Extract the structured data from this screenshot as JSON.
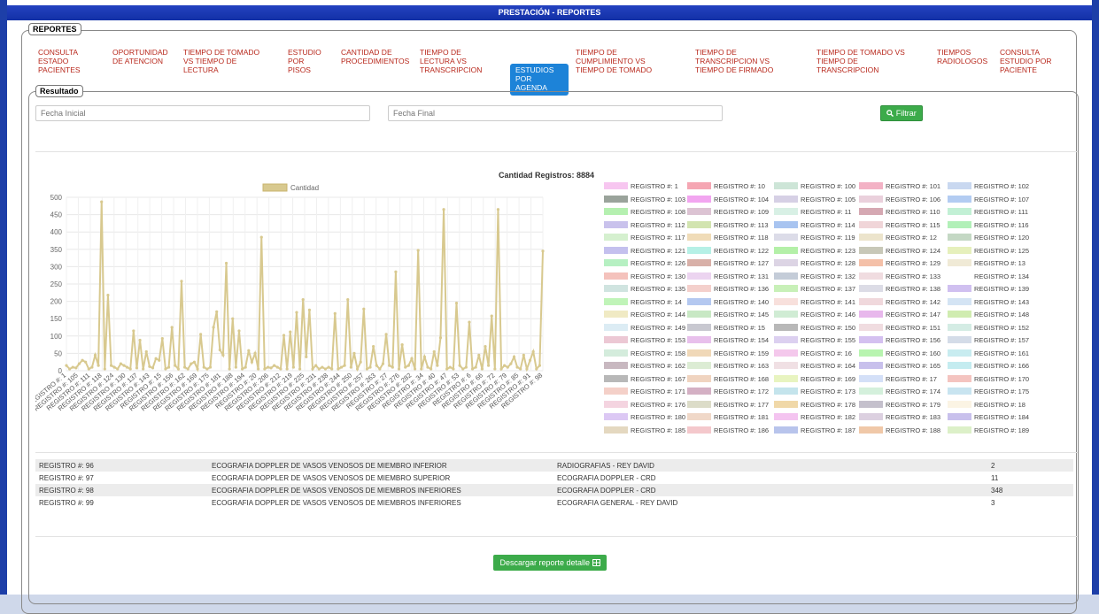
{
  "window_title": "PRESTACIÓN - REPORTES",
  "section_label": "REPORTES",
  "result_label": "Resultado",
  "nav": [
    {
      "label": "CONSULTA ESTADO PACIENTES",
      "active": false
    },
    {
      "label": "OPORTUNIDAD DE ATENCION",
      "active": false
    },
    {
      "label": "TIEMPO DE TOMADO VS TIEMPO DE LECTURA",
      "active": false
    },
    {
      "label": "ESTUDIO POR PISOS",
      "active": false
    },
    {
      "label": "CANTIDAD DE PROCEDIMIENTOS",
      "active": false
    },
    {
      "label": "TIEMPO DE LECTURA VS TRANSCRIPCION",
      "active": false
    },
    {
      "label": "ESTUDIOS POR AGENDA",
      "active": true
    },
    {
      "label": "TIEMPO DE CUMPLIMIENTO VS TIEMPO DE TOMADO",
      "active": false
    },
    {
      "label": "TIEMPO DE TRANSCRIPCION VS TIEMPO DE FIRMADO",
      "active": false
    },
    {
      "label": "TIEMPO DE TOMADO VS TIEMPO DE TRANSCRIPCION",
      "active": false
    },
    {
      "label": "TIEMPOS RADIOLOGOS",
      "active": false
    },
    {
      "label": "CONSULTA ESTUDIO POR PACIENTE",
      "active": false
    }
  ],
  "filters": {
    "fecha_inicial_placeholder": "Fecha Inicial",
    "fecha_final_placeholder": "Fecha Final",
    "filter_button": "Filtrar",
    "filter_icon": "search-icon"
  },
  "count_label": "Cantidad Registros: 8884",
  "chart_data": {
    "type": "line",
    "series": [
      {
        "name": "Cantidad",
        "color": "#d8c98f"
      }
    ],
    "ylim": [
      0,
      500
    ],
    "yticks": [
      0,
      50,
      100,
      150,
      200,
      250,
      300,
      350,
      400,
      450,
      500
    ],
    "grid": true,
    "legend_position": "top",
    "x_tick_labels": [
      "REGISTRO #: 1",
      "REGISTRO #: 105",
      "REGISTRO #: 111",
      "REGISTRO #: 118",
      "REGISTRO #: 124",
      "REGISTRO #: 130",
      "REGISTRO #: 137",
      "REGISTRO #: 143",
      "REGISTRO #: 15",
      "REGISTRO #: 156",
      "REGISTRO #: 162",
      "REGISTRO #: 169",
      "REGISTRO #: 175",
      "REGISTRO #: 181",
      "REGISTRO #: 188",
      "REGISTRO #: 194",
      "REGISTRO #: 20",
      "REGISTRO #: 206",
      "REGISTRO #: 212",
      "REGISTRO #: 219",
      "REGISTRO #: 225",
      "REGISTRO #: 231",
      "REGISTRO #: 238",
      "REGISTRO #: 244",
      "REGISTRO #: 250",
      "REGISTRO #: 257",
      "REGISTRO #: 263",
      "REGISTRO #: 27",
      "REGISTRO #: 276",
      "REGISTRO #: 282",
      "REGISTRO #: 34",
      "REGISTRO #: 40",
      "REGISTRO #: 47",
      "REGISTRO #: 53",
      "REGISTRO #: 6",
      "REGISTRO #: 66",
      "REGISTRO #: 72",
      "REGISTRO #: 79",
      "REGISTRO #: 85",
      "REGISTRO #: 91",
      "REGISTRO #: 98"
    ],
    "values": [
      15,
      5,
      10,
      8,
      20,
      30,
      25,
      5,
      10,
      45,
      15,
      487,
      5,
      218,
      15,
      10,
      5,
      20,
      15,
      10,
      5,
      115,
      8,
      88,
      5,
      55,
      12,
      8,
      35,
      30,
      93,
      5,
      10,
      125,
      15,
      5,
      258,
      10,
      5,
      20,
      25,
      5,
      105,
      10,
      5,
      10,
      125,
      170,
      60,
      45,
      310,
      5,
      150,
      10,
      115,
      5,
      10,
      58,
      25,
      50,
      5,
      385,
      5,
      10,
      8,
      15,
      10,
      5,
      102,
      5,
      112,
      10,
      168,
      5,
      205,
      40,
      175,
      5,
      15,
      5,
      10,
      5,
      10,
      5,
      165,
      5,
      10,
      15,
      205,
      10,
      50,
      5,
      25,
      178,
      5,
      10,
      70,
      15,
      5,
      20,
      105,
      15,
      10,
      285,
      5,
      75,
      10,
      15,
      35,
      5,
      347,
      5,
      40,
      10,
      5,
      55,
      15,
      95,
      465,
      5,
      10,
      5,
      195,
      15,
      5,
      10,
      140,
      5,
      10,
      45,
      5,
      70,
      15,
      158,
      5,
      465,
      5,
      15,
      10,
      20,
      40,
      10,
      5,
      45,
      5,
      30,
      55,
      5,
      15,
      345
    ]
  },
  "legend_items": [
    {
      "label": "REGISTRO #: 1",
      "color": "#f7c6f0"
    },
    {
      "label": "REGISTRO #: 10",
      "color": "#f5a6b3"
    },
    {
      "label": "REGISTRO #: 100",
      "color": "#cde5d7"
    },
    {
      "label": "REGISTRO #: 101",
      "color": "#f3b2c5"
    },
    {
      "label": "REGISTRO #: 102",
      "color": "#c9d8f0"
    },
    {
      "label": "REGISTRO #: 103",
      "color": "#9aa39b"
    },
    {
      "label": "REGISTRO #: 104",
      "color": "#f2a5f0"
    },
    {
      "label": "REGISTRO #: 105",
      "color": "#d6d0e5"
    },
    {
      "label": "REGISTRO #: 106",
      "color": "#ead0dc"
    },
    {
      "label": "REGISTRO #: 107",
      "color": "#b3ccf2"
    },
    {
      "label": "REGISTRO #: 108",
      "color": "#b5f0b0"
    },
    {
      "label": "REGISTRO #: 109",
      "color": "#dcc3d3"
    },
    {
      "label": "REGISTRO #: 11",
      "color": "#d8f0e5"
    },
    {
      "label": "REGISTRO #: 110",
      "color": "#d5a8b2"
    },
    {
      "label": "REGISTRO #: 111",
      "color": "#c2f0d5"
    },
    {
      "label": "REGISTRO #: 112",
      "color": "#c9c2ec"
    },
    {
      "label": "REGISTRO #: 113",
      "color": "#d2e4b0"
    },
    {
      "label": "REGISTRO #: 114",
      "color": "#a8c4f0"
    },
    {
      "label": "REGISTRO #: 115",
      "color": "#f0d5d8"
    },
    {
      "label": "REGISTRO #: 116",
      "color": "#b2f0b8"
    },
    {
      "label": "REGISTRO #: 117",
      "color": "#d5f0cf"
    },
    {
      "label": "REGISTRO #: 118",
      "color": "#f0dcb8"
    },
    {
      "label": "REGISTRO #: 119",
      "color": "#dcdce8"
    },
    {
      "label": "REGISTRO #: 12",
      "color": "#ece4cc"
    },
    {
      "label": "REGISTRO #: 120",
      "color": "#c4d8c4"
    },
    {
      "label": "REGISTRO #: 121",
      "color": "#c4c0ee"
    },
    {
      "label": "REGISTRO #: 122",
      "color": "#b6f0e6"
    },
    {
      "label": "REGISTRO #: 123",
      "color": "#b4f0a8"
    },
    {
      "label": "REGISTRO #: 124",
      "color": "#c8c8b8"
    },
    {
      "label": "REGISTRO #: 125",
      "color": "#e6f0bc"
    },
    {
      "label": "REGISTRO #: 126",
      "color": "#b6f0c2"
    },
    {
      "label": "REGISTRO #: 127",
      "color": "#d8b0a8"
    },
    {
      "label": "REGISTRO #: 128",
      "color": "#dcd4e4"
    },
    {
      "label": "REGISTRO #: 129",
      "color": "#f4c0a8"
    },
    {
      "label": "REGISTRO #: 13",
      "color": "#f0ead6"
    },
    {
      "label": "REGISTRO #: 130",
      "color": "#f4c2bc"
    },
    {
      "label": "REGISTRO #: 131",
      "color": "#ecd4f0"
    },
    {
      "label": "REGISTRO #: 132",
      "color": "#c4ccd8"
    },
    {
      "label": "REGISTRO #: 133",
      "color": "#f0dce0"
    },
    {
      "label": "REGISTRO #: 134",
      "color": "#ffffff"
    },
    {
      "label": "REGISTRO #: 135",
      "color": "#d0e4e0"
    },
    {
      "label": "REGISTRO #: 136",
      "color": "#f4d0cc"
    },
    {
      "label": "REGISTRO #: 137",
      "color": "#c8f0b8"
    },
    {
      "label": "REGISTRO #: 138",
      "color": "#dcdce6"
    },
    {
      "label": "REGISTRO #: 139",
      "color": "#d0c0f0"
    },
    {
      "label": "REGISTRO #: 14",
      "color": "#c0f4b8"
    },
    {
      "label": "REGISTRO #: 140",
      "color": "#b4c8f0"
    },
    {
      "label": "REGISTRO #: 141",
      "color": "#f8e0dc"
    },
    {
      "label": "REGISTRO #: 142",
      "color": "#f0d8dc"
    },
    {
      "label": "REGISTRO #: 143",
      "color": "#d4e4f4"
    },
    {
      "label": "REGISTRO #: 144",
      "color": "#f0eac4"
    },
    {
      "label": "REGISTRO #: 145",
      "color": "#c8e8c4"
    },
    {
      "label": "REGISTRO #: 146",
      "color": "#d0ecd4"
    },
    {
      "label": "REGISTRO #: 147",
      "color": "#e8b8ec"
    },
    {
      "label": "REGISTRO #: 148",
      "color": "#d0ecb0"
    },
    {
      "label": "REGISTRO #: 149",
      "color": "#dcecf4"
    },
    {
      "label": "REGISTRO #: 15",
      "color": "#c8c8d0"
    },
    {
      "label": "REGISTRO #: 150",
      "color": "#b8b8b8"
    },
    {
      "label": "REGISTRO #: 151",
      "color": "#f0dce0"
    },
    {
      "label": "REGISTRO #: 152",
      "color": "#d4ece4"
    },
    {
      "label": "REGISTRO #: 153",
      "color": "#ecc8d4"
    },
    {
      "label": "REGISTRO #: 154",
      "color": "#e8c0ec"
    },
    {
      "label": "REGISTRO #: 155",
      "color": "#dcd0f0"
    },
    {
      "label": "REGISTRO #: 156",
      "color": "#d4c0f0"
    },
    {
      "label": "REGISTRO #: 157",
      "color": "#d4dce8"
    },
    {
      "label": "REGISTRO #: 158",
      "color": "#d4ecdc"
    },
    {
      "label": "REGISTRO #: 159",
      "color": "#f0d8b8"
    },
    {
      "label": "REGISTRO #: 16",
      "color": "#f4c8ec"
    },
    {
      "label": "REGISTRO #: 160",
      "color": "#b8f4b0"
    },
    {
      "label": "REGISTRO #: 161",
      "color": "#c8ecf0"
    },
    {
      "label": "REGISTRO #: 162",
      "color": "#c8b8c0"
    },
    {
      "label": "REGISTRO #: 163",
      "color": "#dcecd4"
    },
    {
      "label": "REGISTRO #: 164",
      "color": "#f0e0e4"
    },
    {
      "label": "REGISTRO #: 165",
      "color": "#c8c0ec"
    },
    {
      "label": "REGISTRO #: 166",
      "color": "#c4ecf0"
    },
    {
      "label": "REGISTRO #: 167",
      "color": "#b8b8b8"
    },
    {
      "label": "REGISTRO #: 168",
      "color": "#f0d4c0"
    },
    {
      "label": "REGISTRO #: 169",
      "color": "#e8f4c0"
    },
    {
      "label": "REGISTRO #: 17",
      "color": "#d4e0f8"
    },
    {
      "label": "REGISTRO #: 170",
      "color": "#f4c4c0"
    },
    {
      "label": "REGISTRO #: 171",
      "color": "#f4d0c8"
    },
    {
      "label": "REGISTRO #: 172",
      "color": "#d4b0c4"
    },
    {
      "label": "REGISTRO #: 173",
      "color": "#c4e4ec"
    },
    {
      "label": "REGISTRO #: 174",
      "color": "#d4f0dc"
    },
    {
      "label": "REGISTRO #: 175",
      "color": "#c8e4f0"
    },
    {
      "label": "REGISTRO #: 176",
      "color": "#f4d4e0"
    },
    {
      "label": "REGISTRO #: 177",
      "color": "#dcdcc8"
    },
    {
      "label": "REGISTRO #: 178",
      "color": "#f0d8a8"
    },
    {
      "label": "REGISTRO #: 179",
      "color": "#c4c0cc"
    },
    {
      "label": "REGISTRO #: 18",
      "color": "#fbf4e4"
    },
    {
      "label": "REGISTRO #: 180",
      "color": "#dcc8f4"
    },
    {
      "label": "REGISTRO #: 181",
      "color": "#f0d8c8"
    },
    {
      "label": "REGISTRO #: 182",
      "color": "#f4c4f0"
    },
    {
      "label": "REGISTRO #: 183",
      "color": "#dcd0e0"
    },
    {
      "label": "REGISTRO #: 184",
      "color": "#c8c0ec"
    },
    {
      "label": "REGISTRO #: 185",
      "color": "#e4d8c0"
    },
    {
      "label": "REGISTRO #: 186",
      "color": "#f4c8cc"
    },
    {
      "label": "REGISTRO #: 187",
      "color": "#b8c4ec"
    },
    {
      "label": "REGISTRO #: 188",
      "color": "#f0c8a8"
    },
    {
      "label": "REGISTRO #: 189",
      "color": "#dcf0c8"
    }
  ],
  "table_rows": [
    {
      "registro": "REGISTRO #: 96",
      "estudio": "ECOGRAFIA DOPPLER DE VASOS VENOSOS DE MIEMBRO INFERIOR",
      "agenda": "RADIOGRAFIAS - REY DAVID",
      "cantidad": "2"
    },
    {
      "registro": "REGISTRO #: 97",
      "estudio": "ECOGRAFIA DOPPLER DE VASOS VENOSOS DE MIEMBRO SUPERIOR",
      "agenda": "ECOGRAFIA DOPPLER - CRD",
      "cantidad": "11"
    },
    {
      "registro": "REGISTRO #: 98",
      "estudio": "ECOGRAFIA DOPPLER DE VASOS VENOSOS DE MIEMBROS INFERIORES",
      "agenda": "ECOGRAFIA DOPPLER - CRD",
      "cantidad": "348"
    },
    {
      "registro": "REGISTRO #: 99",
      "estudio": "ECOGRAFIA DOPPLER DE VASOS VENOSOS DE MIEMBROS INFERIORES",
      "agenda": "ECOGRAFIA GENERAL - REY DAVID",
      "cantidad": "3"
    }
  ],
  "download_button": "Descargar reporte detalle",
  "download_icon": "table-icon"
}
